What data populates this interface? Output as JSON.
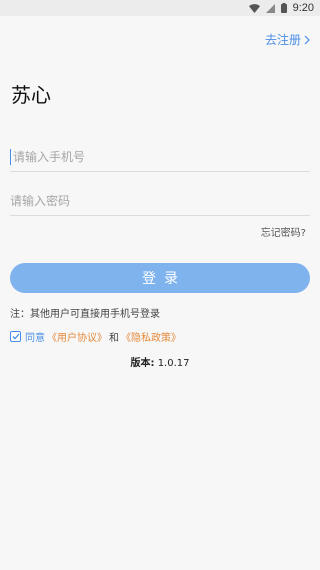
{
  "status_bar": {
    "time": "9:20"
  },
  "header": {
    "register_label": "去注册"
  },
  "app": {
    "title": "苏心"
  },
  "form": {
    "phone_placeholder": "请输入手机号",
    "password_placeholder": "请输入密码",
    "forgot_label": "忘记密码?",
    "login_label": "登录"
  },
  "note": {
    "text": "注：其他用户可直接用手机号登录"
  },
  "agreement": {
    "checked": true,
    "agree_label": "同意",
    "user_agreement": "《用户协议》",
    "and_label": "和",
    "privacy_policy": "《隐私政策》"
  },
  "version": {
    "label": "版本:",
    "value": "1.0.17"
  },
  "colors": {
    "accent": "#4a8ee6",
    "button": "#7fb3ee",
    "link_orange": "#e58a3b"
  }
}
